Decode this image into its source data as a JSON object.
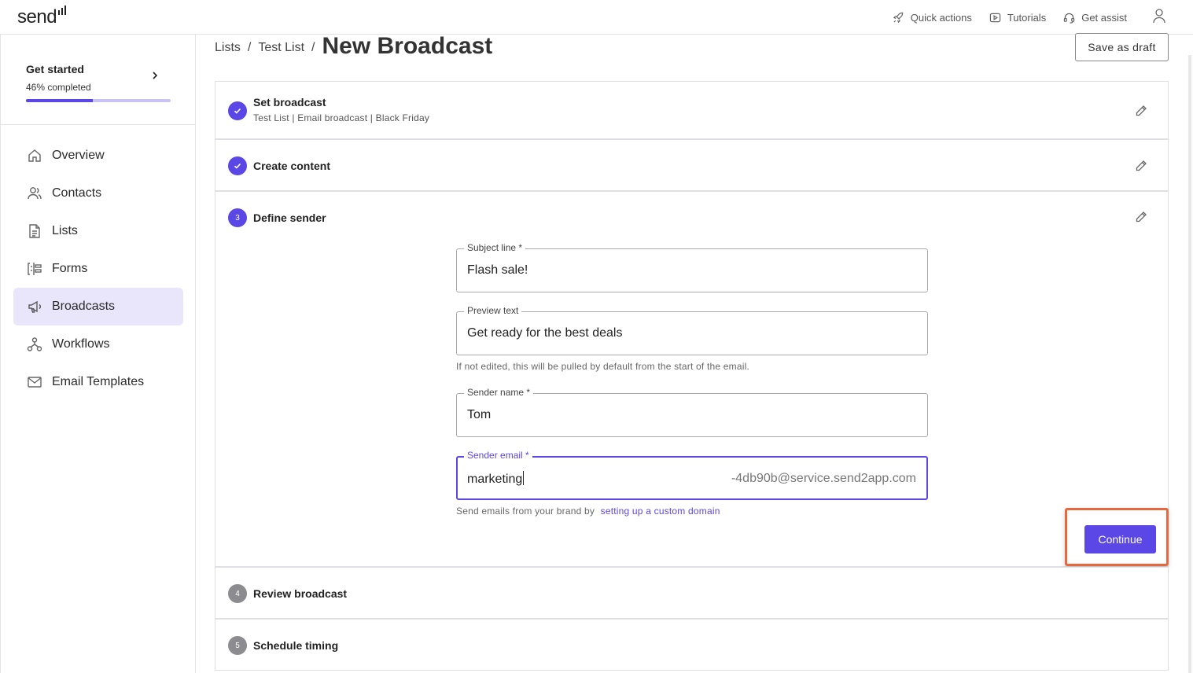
{
  "app": {
    "logo_text": "send"
  },
  "topbar": {
    "quick_actions": "Quick actions",
    "tutorials": "Tutorials",
    "get_assist": "Get assist"
  },
  "sidebar": {
    "get_started": {
      "title": "Get started",
      "progress_label": "46% completed",
      "progress_fraction": 0.46
    },
    "items": [
      {
        "label": "Overview",
        "icon": "home-icon",
        "active": false
      },
      {
        "label": "Contacts",
        "icon": "contacts-icon",
        "active": false
      },
      {
        "label": "Lists",
        "icon": "document-icon",
        "active": false
      },
      {
        "label": "Forms",
        "icon": "forms-icon",
        "active": false
      },
      {
        "label": "Broadcasts",
        "icon": "megaphone-icon",
        "active": true
      },
      {
        "label": "Workflows",
        "icon": "workflow-icon",
        "active": false
      },
      {
        "label": "Email Templates",
        "icon": "mail-icon",
        "active": false
      }
    ]
  },
  "breadcrumb": {
    "items": [
      "Lists",
      "Test List"
    ],
    "separator": "/",
    "current": "New Broadcast"
  },
  "actions": {
    "save_draft": "Save as draft",
    "continue": "Continue"
  },
  "steps": [
    {
      "number": "1",
      "title": "Set broadcast",
      "subtitle": "Test List | Email broadcast | Black Friday",
      "state": "done"
    },
    {
      "number": "2",
      "title": "Create content",
      "subtitle": "",
      "state": "done"
    },
    {
      "number": "3",
      "title": "Define sender",
      "subtitle": "",
      "state": "current"
    },
    {
      "number": "4",
      "title": "Review broadcast",
      "subtitle": "",
      "state": "pending"
    },
    {
      "number": "5",
      "title": "Schedule timing",
      "subtitle": "",
      "state": "pending"
    }
  ],
  "form": {
    "subject": {
      "label": "Subject line *",
      "value": "Flash sale!"
    },
    "preview": {
      "label": "Preview text",
      "value": "Get ready for the best deals",
      "helper": "If not edited, this will be pulled by default from the start of the email."
    },
    "sender_name": {
      "label": "Sender name *",
      "value": "Tom"
    },
    "sender_email": {
      "label": "Sender email *",
      "value": "marketing",
      "suffix": "-4db90b@service.send2app.com",
      "helper": "Send emails from your brand by",
      "helper_link": "setting up a custom domain"
    }
  },
  "colors": {
    "accent": "#5b46e6",
    "highlight": "#e8673f",
    "active_nav_bg": "#e9e5fb"
  }
}
